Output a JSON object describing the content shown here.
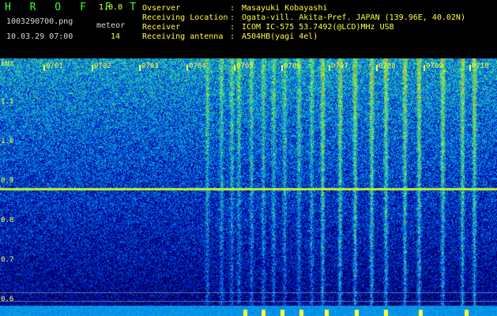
{
  "app": {
    "name": "H R O F F T",
    "version": "1.0.0"
  },
  "file": {
    "name": "1003290700.png",
    "datetime": "10.03.29 07:00"
  },
  "meteor": {
    "label": "meteor",
    "count": "14"
  },
  "info": [
    {
      "key": "Ovserver",
      "sep": ":",
      "value": "Masayuki Kobayashi"
    },
    {
      "key": "Receiving Location",
      "sep": ":",
      "value": "Ogata-vill. Akita-Pref. JAPAN (139.96E, 40.02N)"
    },
    {
      "key": "Receiver",
      "sep": ":",
      "value": "ICOM IC-575 53.7492(@LCD)MHz USB"
    },
    {
      "key": "Receiving antenna",
      "sep": ":",
      "value": "A504HB(yagi 4el)"
    }
  ],
  "axis": {
    "unit": "kHz",
    "y_ticks": [
      "1.1",
      "1.0",
      "0.9",
      "0.8",
      "0.7",
      "0.6"
    ],
    "time_ticks": [
      "0701",
      "0702",
      "0703",
      "0704",
      "0705",
      "0706",
      "0707",
      "0708",
      "0709",
      "0710"
    ]
  },
  "colors": {
    "header_green": "#3cff3c",
    "label_yellow": "#ffff3c",
    "header_white": "#d8d8d8",
    "background": "#000000"
  }
}
